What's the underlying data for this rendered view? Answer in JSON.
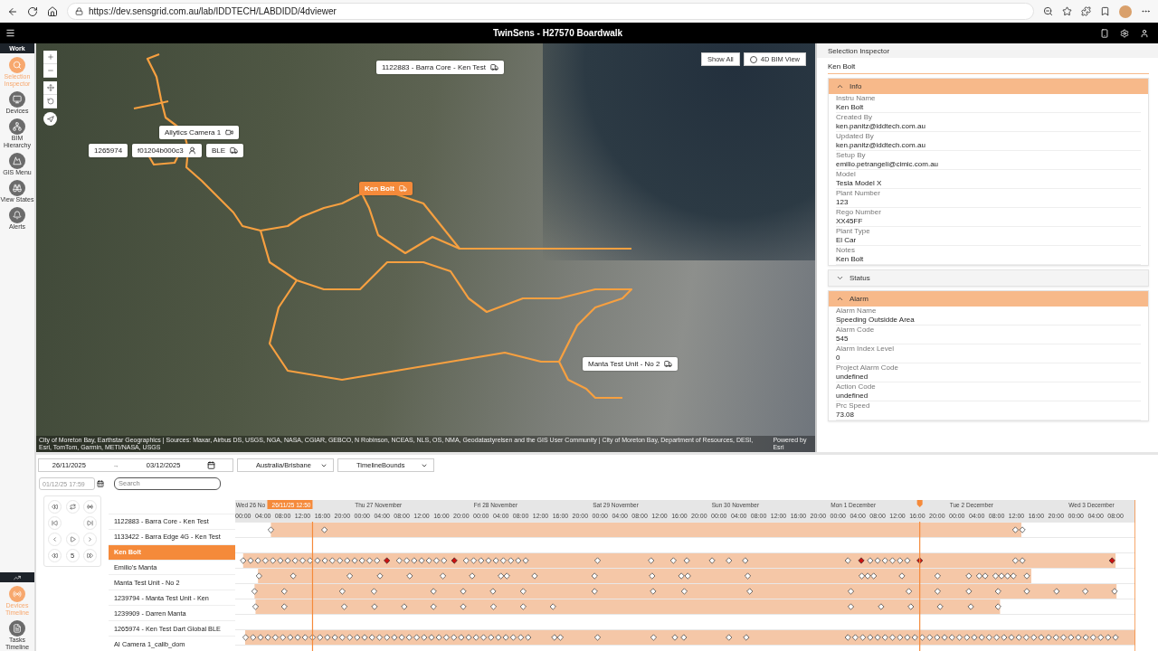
{
  "browser": {
    "url": "https://dev.sensgrid.com.au/lab/IDDTECH/LABDIDD/4dviewer"
  },
  "header": {
    "title": "TwinSens - H27570 Boardwalk"
  },
  "sidebar": {
    "groups": [
      {
        "title": "Work",
        "items": [
          {
            "label": "Selection Inspector",
            "kind": "search",
            "selected": true
          },
          {
            "label": "Devices",
            "kind": "device",
            "selected": false
          },
          {
            "label": "BIM Hierarchy",
            "kind": "hierarchy",
            "selected": false
          },
          {
            "label": "GIS Menu",
            "kind": "mountain",
            "selected": false
          },
          {
            "label": "View States",
            "kind": "binoculars",
            "selected": false
          },
          {
            "label": "Alerts",
            "kind": "alert",
            "selected": false
          }
        ]
      },
      {
        "items": [
          {
            "label": "Devices Timeline",
            "kind": "signal",
            "selected": true
          },
          {
            "label": "Tasks Timeline",
            "kind": "document",
            "selected": false
          }
        ]
      }
    ]
  },
  "map": {
    "buttons": [
      {
        "label": "Show All",
        "kind": "plain"
      },
      {
        "label": "4D BIM View",
        "kind": "toggle",
        "checked": false
      }
    ],
    "markers": [
      {
        "label": "1122883 - Barra Core - Ken Test",
        "kind": "truck",
        "selected": false
      },
      {
        "label": "Allytics Camera 1",
        "kind": "camera",
        "selected": false
      },
      {
        "label": "1265974",
        "kind": "none",
        "selected": false
      },
      {
        "label": "f01204b000c3",
        "kind": "person",
        "selected": false
      },
      {
        "label": "BLE",
        "kind": "truck",
        "selected": false
      },
      {
        "label": "Ken Bolt",
        "kind": "truck",
        "selected": true
      },
      {
        "label": "Manta Test Unit - No 2",
        "kind": "truck",
        "selected": false
      }
    ],
    "attribution": "City of Moreton Bay, Earthstar Geographics | Sources: Maxar, Airbus DS, USGS, NGA, NASA, CGIAR, GEBCO, N Robinson, NCEAS, NLS, OS, NMA, Geodatastyrelsen and the GIS User Community | City of Moreton Bay, Department of Resources, DESI, Esri, TomTom, Garmin, METI/NASA, USGS",
    "powered_by": "Powered by Esri"
  },
  "inspector": {
    "title": "Selection Inspector",
    "name": "Ken Bolt",
    "sections": [
      {
        "title": "Info",
        "expanded": true,
        "fields": [
          {
            "label": "Instru Name",
            "value": "Ken Bolt"
          },
          {
            "label": "Created By",
            "value": "ken.panitz@iddtech.com.au"
          },
          {
            "label": "Updated By",
            "value": "ken.panitz@iddtech.com.au"
          },
          {
            "label": "Setup By",
            "value": "emilio.petrangeli@cimic.com.au"
          },
          {
            "label": "Model",
            "value": "Tesla Model X"
          },
          {
            "label": "Plant Number",
            "value": "123"
          },
          {
            "label": "Rego Number",
            "value": "XX45FF"
          },
          {
            "label": "Plant Type",
            "value": "El Car"
          },
          {
            "label": "Notes",
            "value": "Ken Bolt"
          }
        ]
      },
      {
        "title": "Status",
        "expanded": false
      },
      {
        "title": "Alarm",
        "expanded": true,
        "fields": [
          {
            "label": "Alarm Name",
            "value": "Speeding Outsidde Area"
          },
          {
            "label": "Alarm Code",
            "value": "545"
          },
          {
            "label": "Alarm Index Level",
            "value": "0"
          },
          {
            "label": "Project Alarm Code",
            "value": "undefined"
          },
          {
            "label": "Action Code",
            "value": "undefined"
          },
          {
            "label": "Prc Speed",
            "value": "73.08"
          }
        ]
      }
    ]
  },
  "timeline": {
    "range": {
      "start": "26/11/2025",
      "separator": "→",
      "end": "03/12/2025"
    },
    "selects": [
      "Australia/Brisbane",
      "TimelineBounds"
    ],
    "time_field": {
      "placeholder": "01/12/25 17:59"
    },
    "button_rows": [
      [
        {
          "kind": "rewind"
        },
        {
          "kind": "repeat"
        },
        {
          "kind": "broadcast"
        }
      ],
      [
        {
          "kind": "skip-back"
        },
        {
          "kind": "skip-forward"
        }
      ],
      [
        {
          "kind": "prev"
        },
        {
          "kind": "play"
        },
        {
          "kind": "next"
        }
      ],
      [
        {
          "kind": "rewind"
        },
        {
          "kind": "speed",
          "label": "5"
        },
        {
          "kind": "fast-forward"
        }
      ]
    ],
    "search": {
      "placeholder": "Search"
    },
    "days": [
      {
        "label": "Wed 26 No",
        "hours": [
          "00:00",
          "04:00",
          "08:00",
          "12:00",
          "16:00",
          "20:00"
        ]
      },
      {
        "label": "Thu 27 November",
        "hours": [
          "00:00",
          "04:00",
          "08:00",
          "12:00",
          "16:00",
          "20:00"
        ]
      },
      {
        "label": "Fri 28 November",
        "hours": [
          "00:00",
          "04:00",
          "08:00",
          "12:00",
          "16:00",
          "20:00"
        ]
      },
      {
        "label": "Sat 29 November",
        "hours": [
          "00:00",
          "04:00",
          "08:00",
          "12:00",
          "16:00",
          "20:00"
        ]
      },
      {
        "label": "Sun 30 November",
        "hours": [
          "00:00",
          "04:00",
          "08:00",
          "12:00",
          "16:00",
          "20:00"
        ]
      },
      {
        "label": "Mon 1 December",
        "hours": [
          "00:00",
          "04:00",
          "08:00",
          "12:00",
          "16:00",
          "20:00"
        ]
      },
      {
        "label": "Tue 2 December",
        "hours": [
          "00:00",
          "04:00",
          "08:00",
          "12:00",
          "16:00",
          "20:00"
        ]
      },
      {
        "label": "Wed 3 December",
        "hours": [
          "00:00",
          "04:00",
          "08:00"
        ]
      }
    ],
    "cursor": {
      "label": "26/11/25 12:50"
    },
    "rows": [
      {
        "name": "1122883 - Barra Core - Ken Test",
        "selected": false
      },
      {
        "name": "1133422 - Barra Edge 4G - Ken Test",
        "selected": false
      },
      {
        "name": "Ken Bolt",
        "selected": true
      },
      {
        "name": "Emilio's Manta",
        "selected": false
      },
      {
        "name": "Manta Test Unit - No 2",
        "selected": false
      },
      {
        "name": "1239794 - Manta Test Unit - Ken",
        "selected": false
      },
      {
        "name": "1239909 - Darren Manta",
        "selected": false
      },
      {
        "name": "1265974 - Ken Test Dart Global BLE",
        "selected": false
      },
      {
        "name": "AI Camera 1_calib_dom",
        "selected": false
      }
    ]
  }
}
